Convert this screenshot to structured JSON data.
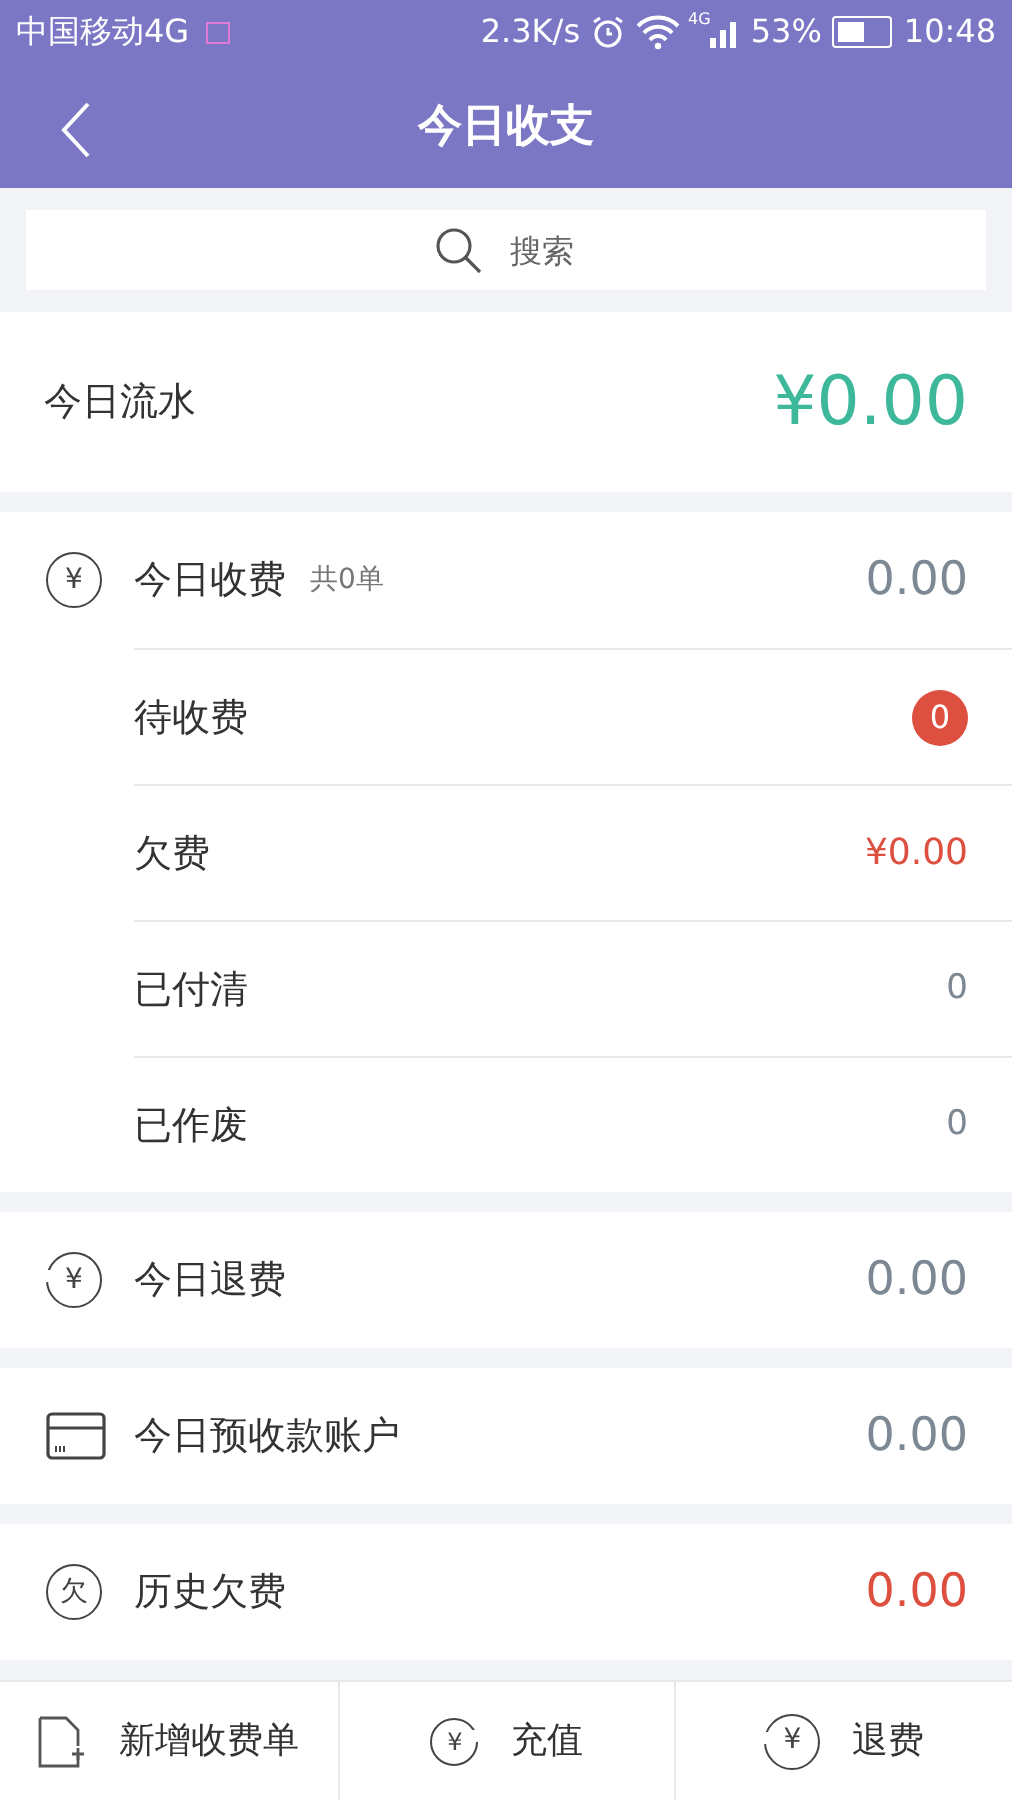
{
  "status_bar": {
    "carrier": "中国移动4G",
    "speed": "2.3K/s",
    "network": "4G",
    "battery": "53%",
    "time": "10:48"
  },
  "header": {
    "title": "今日收支"
  },
  "search": {
    "placeholder": "搜索"
  },
  "flow": {
    "label": "今日流水",
    "value": "¥0.00"
  },
  "sections": [
    {
      "kind": "circle",
      "icon_text": "¥",
      "label": "今日收费",
      "note": "共0单",
      "value": "0.00",
      "color": "#7d8895",
      "children": [
        {
          "label": "待收费",
          "value": "0",
          "kind": "badge"
        },
        {
          "label": "欠费",
          "value": "¥0.00",
          "kind": "amount"
        },
        {
          "label": "已付清",
          "value": "0",
          "kind": "count"
        },
        {
          "label": "已作废",
          "value": "0",
          "kind": "count"
        }
      ]
    },
    {
      "kind": "refund",
      "icon_text": "¥",
      "label": "今日退费",
      "value": "0.00",
      "color": "#7d8895"
    },
    {
      "kind": "card",
      "label": "今日预收款账户",
      "value": "0.00",
      "color": "#7d8895"
    },
    {
      "kind": "circle",
      "icon_text": "欠",
      "label": "历史欠费",
      "value": "0.00",
      "color": "#dd4f3f"
    }
  ],
  "actions": [
    {
      "kind": "doc",
      "label": "新增收费单"
    },
    {
      "kind": "recharge",
      "icon_text": "¥",
      "label": "充值"
    },
    {
      "kind": "refund",
      "icon_text": "¥",
      "label": "退费"
    }
  ]
}
